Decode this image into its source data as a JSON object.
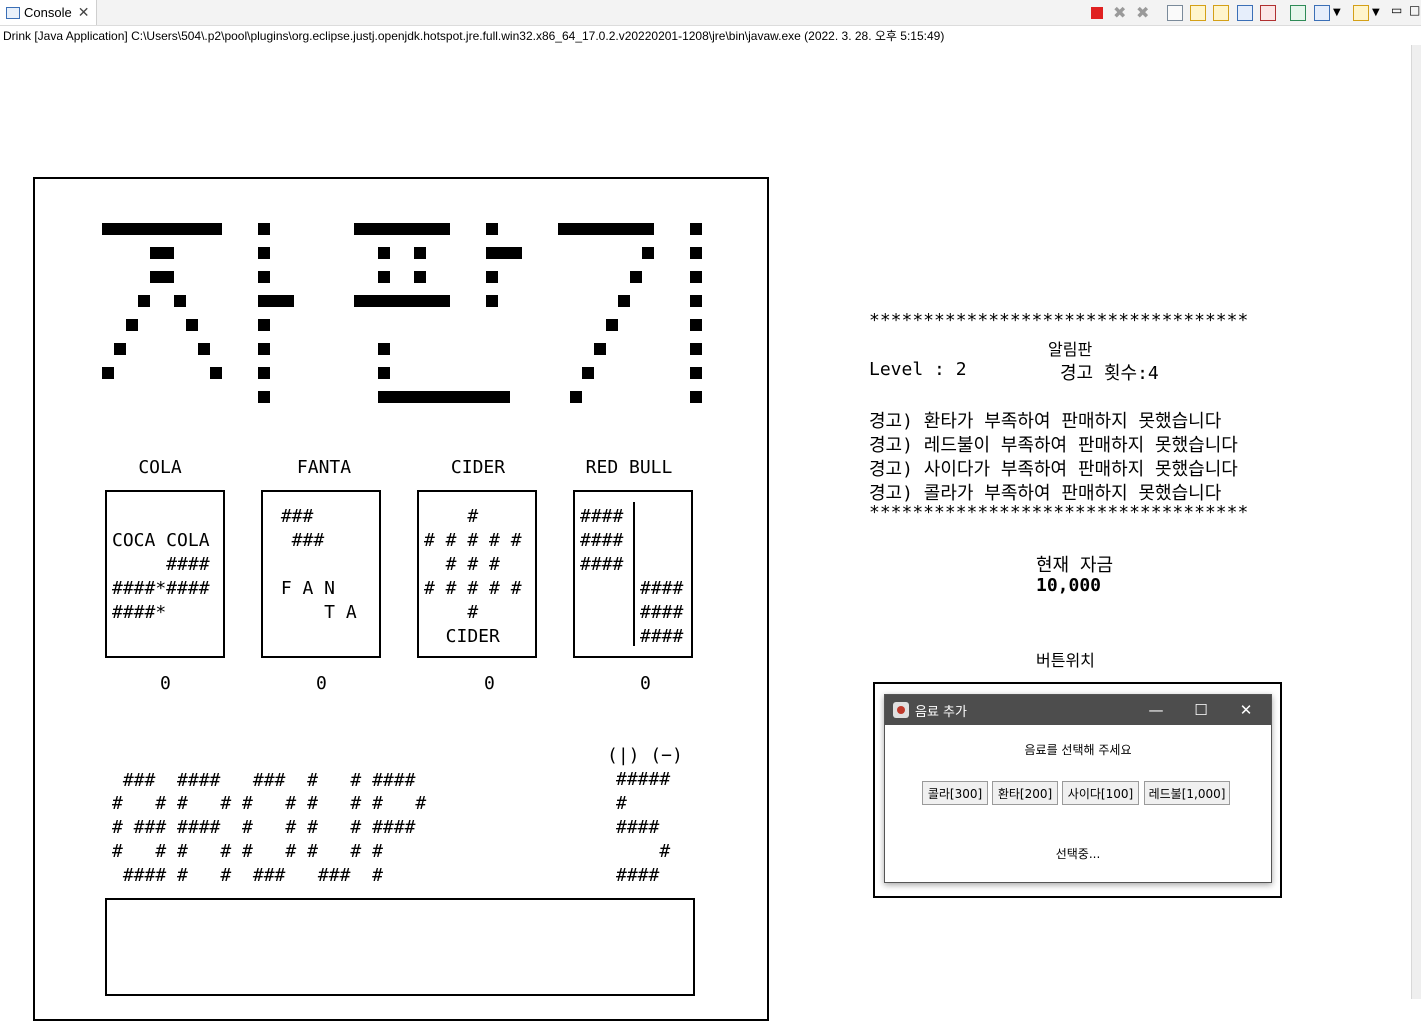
{
  "console": {
    "tab_label": "Console",
    "launch_line": "Drink [Java Application] C:\\Users\\504\\.p2\\pool\\plugins\\org.eclipse.justj.openjdk.hotspot.jre.full.win32.x86_64_17.0.2.v20220201-1208\\jre\\bin\\javaw.exe  (2022. 3. 28. 오후 5:15:49)"
  },
  "machine": {
    "drinks": [
      {
        "name": "COLA",
        "art": [
          "",
          "COCA COLA",
          "     ####",
          "####*####",
          "####*",
          "",
          ""
        ],
        "count": "0"
      },
      {
        "name": "FANTA",
        "art": [
          " ###",
          "  ###",
          "",
          " F A N",
          "     T A",
          "",
          ""
        ],
        "count": "0"
      },
      {
        "name": "CIDER",
        "art": [
          "    #",
          "# # # # #",
          "  # # #",
          "# # # # #",
          "    #",
          "  CIDER",
          ""
        ],
        "count": "0"
      },
      {
        "name": "RED BULL",
        "art": [
          "####",
          "####",
          "####",
          "",
          "",
          "",
          ""
        ],
        "art_right": [
          "",
          "",
          "",
          "####",
          "####",
          "####"
        ],
        "count": "0"
      }
    ],
    "deposit_lines": [
      " ###  ####   ###  #   # ####",
      "#   # #   # #   # #   # #   #",
      "# ### ####  #   # #   # ####",
      "#   # #   # #   # #   # #",
      " #### #   #  ###   ###  #"
    ],
    "coin_label": "(|) (−)",
    "coin_lines": [
      "#####",
      "#",
      "####",
      "    #",
      "####"
    ]
  },
  "notice": {
    "stars": "***********************************",
    "title": "알림판",
    "level": "Level : 2",
    "warn_count": "경고 횟수:4",
    "warnings": [
      "경고) 환타가 부족하여 판매하지 못했습니다",
      "경고) 레드불이 부족하여 판매하지 못했습니다",
      "경고) 사이다가 부족하여 판매하지 못했습니다",
      "경고) 콜라가 부족하여 판매하지 못했습니다"
    ],
    "funds_label": "현재 자금",
    "funds_value": "10,000",
    "button_label": "버튼위치"
  },
  "dialog": {
    "title": "음료 추가",
    "prompt": "음료를 선택해 주세요",
    "buttons": [
      "콜라[300]",
      "환타[200]",
      "사이다[100]",
      "레드불[1,000]"
    ],
    "status": "선택중..."
  },
  "colors": {
    "stop_red": "#e02020",
    "titlebar": "#4d4d4d"
  }
}
